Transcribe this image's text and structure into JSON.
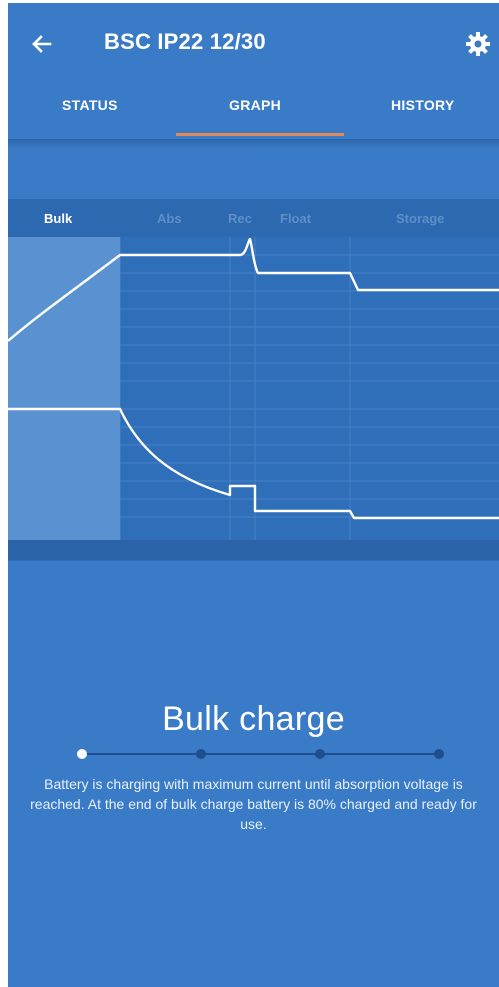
{
  "app": {
    "title": "BSC IP22 12/30",
    "back_icon": "arrow-left-icon",
    "settings_icon": "gear-icon"
  },
  "tabs": [
    {
      "label": "STATUS",
      "selected": false
    },
    {
      "label": "GRAPH",
      "selected": true
    },
    {
      "label": "HISTORY",
      "selected": false
    }
  ],
  "graph": {
    "phases": [
      {
        "label": "Bulk",
        "active": true
      },
      {
        "label": "Abs",
        "active": false
      },
      {
        "label": "Rec",
        "active": false
      },
      {
        "label": "Float",
        "active": false
      },
      {
        "label": "Storage",
        "active": false
      }
    ]
  },
  "info": {
    "title": "Bulk charge",
    "description": "Battery is charging with maximum current until absorption voltage is reached. At the end of bulk charge battery is 80% charged and ready for use.",
    "pager_total": 4,
    "pager_selected": 1
  },
  "colors": {
    "background": "#3a7bc8",
    "tab_indicator": "#e38a5a",
    "graph_panel": "#2f6eb9",
    "active_phase_highlight": "#5a91d1"
  }
}
